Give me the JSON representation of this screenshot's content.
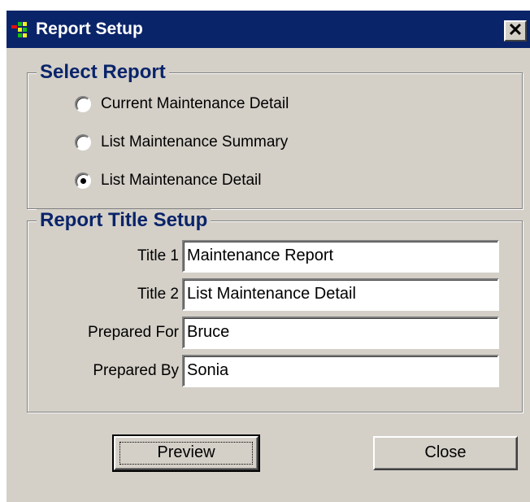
{
  "window": {
    "title": "Report Setup",
    "close_glyph": "✕"
  },
  "select_report": {
    "legend": "Select Report",
    "options": [
      {
        "label": "Current Maintenance Detail",
        "selected": false
      },
      {
        "label": "List Maintenance Summary",
        "selected": false
      },
      {
        "label": "List Maintenance Detail",
        "selected": true
      }
    ]
  },
  "title_setup": {
    "legend": "Report Title Setup",
    "fields": [
      {
        "label": "Title 1",
        "value": "Maintenance Report"
      },
      {
        "label": "Title 2",
        "value": "List Maintenance Detail"
      },
      {
        "label": "Prepared For",
        "value": "Bruce"
      },
      {
        "label": "Prepared By",
        "value": "Sonia"
      }
    ]
  },
  "buttons": {
    "preview": "Preview",
    "close": "Close"
  },
  "colors": {
    "titlebar": "#0a246a",
    "face": "#d4d0c8",
    "legend_text": "#0a246a"
  }
}
